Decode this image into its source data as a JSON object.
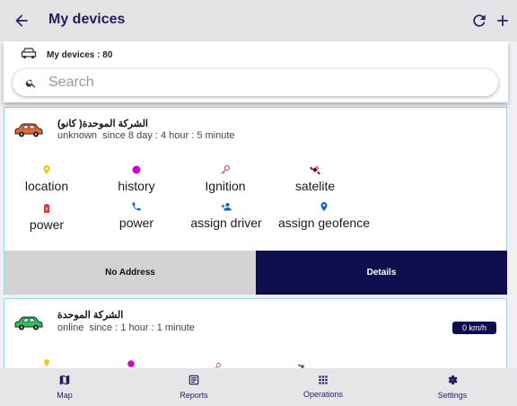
{
  "appbar": {
    "title": "My devices"
  },
  "summary": {
    "devices_count_label": "My devices : 80"
  },
  "search": {
    "placeholder": "Search",
    "value": ""
  },
  "devices": [
    {
      "name": "(الشركة الموحدة( كانو",
      "status": "unknown",
      "since": "since 8 day : 4 hour : 5 minute",
      "car_color": "#e9662e",
      "actions": {
        "location": "location",
        "history": "history",
        "ignition": "Ignition",
        "satelite": "satelite",
        "power_battery": "power",
        "power_phone": "power",
        "assign_driver": "assign driver",
        "assign_geofence": "assign geofence"
      },
      "address_label": "No Address",
      "details_label": "Details"
    },
    {
      "name": "الشركة الموحدة",
      "status": "online",
      "since": "since : 1 hour : 1 minute",
      "speed": "0 km/h",
      "car_color": "#2fc15a"
    }
  ],
  "colors": {
    "accent_dark": "#0e0e4f",
    "title": "#241b63",
    "location_icon": "#f5c518",
    "history_icon": "#cc00cc",
    "ignition_icon": "#d35aa0",
    "satelite_icon": "#9b1b2a",
    "battery_icon": "#e53935",
    "phone_icon": "#1565c0"
  },
  "bottom_nav": [
    {
      "label": "Map",
      "icon": "map-icon"
    },
    {
      "label": "Reports",
      "icon": "reports-icon"
    },
    {
      "label": "Operations",
      "icon": "apps-grid-icon"
    },
    {
      "label": "Settings",
      "icon": "settings-icon"
    }
  ]
}
